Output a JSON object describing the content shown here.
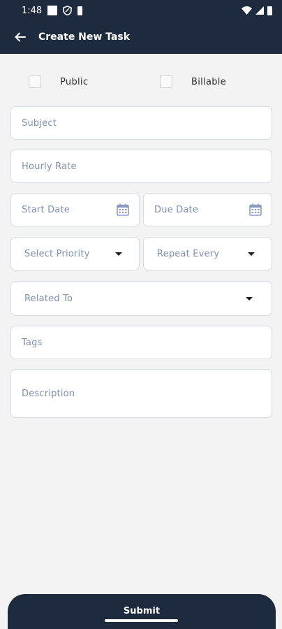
{
  "status_bar": {
    "time": "1:48"
  },
  "app_bar": {
    "title": "Create New Task"
  },
  "checkboxes": {
    "public_label": "Public",
    "billable_label": "Billable"
  },
  "fields": {
    "subject_placeholder": "Subject",
    "hourly_rate_placeholder": "Hourly Rate",
    "start_date_placeholder": "Start Date",
    "due_date_placeholder": "Due Date",
    "priority_placeholder": "Select Priority",
    "repeat_placeholder": "Repeat Every",
    "related_to_placeholder": "Related To",
    "tags_placeholder": "Tags",
    "description_placeholder": "Description"
  },
  "submit_label": "Submit",
  "colors": {
    "primary": "#1e2a3d",
    "background": "#f3f3f3",
    "placeholder": "#7f8fb3",
    "field_border": "#d7dbe3"
  },
  "icons": [
    "back-arrow-icon",
    "calendar-icon",
    "dropdown-caret-icon",
    "wifi-icon",
    "signal-icon",
    "battery-icon"
  ]
}
